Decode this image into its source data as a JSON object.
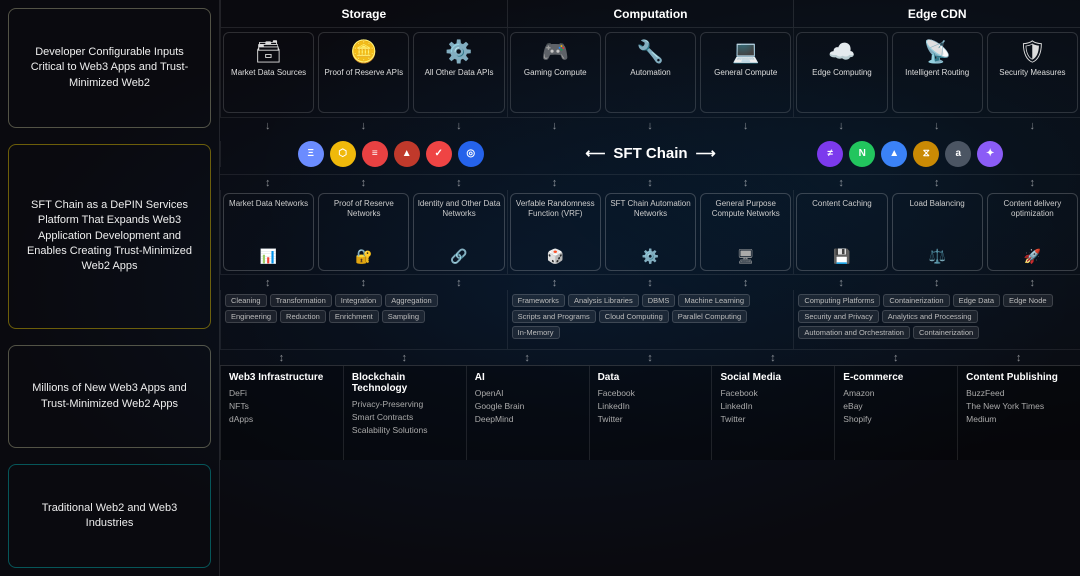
{
  "left": {
    "card1": {
      "text": "Developer Configurable Inputs Critical to Web3 Apps and Trust-Minimized Web2"
    },
    "card2": {
      "text": "SFT Chain as a DePIN Services Platform That Expands Web3 Application Development and Enables Creating Trust-Minimized Web2 Apps"
    },
    "card3": {
      "text": "Millions of New Web3 Apps and Trust-Minimized Web2 Apps"
    },
    "card4": {
      "text": "Traditional Web2 and Web3 Industries"
    }
  },
  "columns": {
    "storage": {
      "header": "Storage",
      "subcols": [
        {
          "label": "Market Data Sources",
          "icon": "🗃"
        },
        {
          "label": "Proof of Reserve APIs",
          "icon": "🪙"
        },
        {
          "label": "All Other Data APIs",
          "icon": "⚙️"
        }
      ],
      "networks": [
        {
          "label": "Market Data Networks",
          "icon": "📊"
        },
        {
          "label": "Proof of Reserve Networks",
          "icon": "🔐"
        },
        {
          "label": "Identity and Other Data Networks",
          "icon": "🔗"
        }
      ],
      "tags_row1": [
        "Cleaning",
        "Transformation",
        "Integration",
        "Aggregation"
      ],
      "tags_row2": [
        "Engineering",
        "Reduction",
        "Enrichment",
        "Sampling"
      ],
      "logos": [
        {
          "color": "#6b8cff",
          "text": "Ξ"
        },
        {
          "color": "#f0b90b",
          "text": "⬡"
        },
        {
          "color": "#e84142",
          "text": "≡"
        },
        {
          "color": "#e84142",
          "text": "▲"
        },
        {
          "color": "#ef4444",
          "text": "✓"
        },
        {
          "color": "#2563eb",
          "text": "◎"
        }
      ]
    },
    "computation": {
      "header": "Computation",
      "subcols": [
        {
          "label": "Gaming Compute",
          "icon": "🎮"
        },
        {
          "label": "Automation",
          "icon": "🔧"
        },
        {
          "label": "General Compute",
          "icon": "💻"
        }
      ],
      "networks": [
        {
          "label": "Verfable Randomness Function (VRF)",
          "icon": "🎲"
        },
        {
          "label": "SFT Chain Automation Networks",
          "icon": "⚙️"
        },
        {
          "label": "General Purpose Compute Networks",
          "icon": "🖥"
        }
      ],
      "tags_row1": [
        "Frameworks",
        "Analysis Libraries",
        "DBMS",
        "Machine Learning"
      ],
      "tags_row2": [
        "Scripts and Programs",
        "Cloud Computing",
        "Parallel Computing",
        "In-Memory"
      ],
      "sft_chain_label": "SFT Chain"
    },
    "edge_cdn": {
      "header": "Edge CDN",
      "subcols": [
        {
          "label": "Edge Computing",
          "icon": "☁️"
        },
        {
          "label": "Intelligent Routing",
          "icon": "📡"
        },
        {
          "label": "Security Measures",
          "icon": "🛡"
        }
      ],
      "networks": [
        {
          "label": "Content Caching",
          "icon": "💾"
        },
        {
          "label": "Load Balancing",
          "icon": "⚖️"
        },
        {
          "label": "Content delivery optimization",
          "icon": "🚀"
        }
      ],
      "tags_row1": [
        "Computing Platforms",
        "Containerization",
        "Edge Data",
        "Edge Node"
      ],
      "tags_row2": [
        "Security and Privacy",
        "Analytics and Processing",
        "Automation and Orchestration",
        "Containerization"
      ],
      "logos": [
        {
          "color": "#7c3aed",
          "text": "≠"
        },
        {
          "color": "#22c55e",
          "text": "N"
        },
        {
          "color": "#3b82f6",
          "text": "▲"
        },
        {
          "color": "#eab308",
          "text": "⧖"
        },
        {
          "color": "#6b7280",
          "text": "a"
        },
        {
          "color": "#8b5cf6",
          "text": "✦"
        }
      ]
    }
  },
  "industries": [
    {
      "title": "Web3 Infrastructure",
      "items": [
        "DeFi",
        "NFTs",
        "dApps"
      ]
    },
    {
      "title": "Blockchain Technology",
      "items": [
        "Privacy-Preserving",
        "Smart Contracts",
        "Scalability Solutions"
      ]
    },
    {
      "title": "AI",
      "items": [
        "OpenAI",
        "Google Brain",
        "DeepMind"
      ]
    },
    {
      "title": "Data",
      "items": [
        "Facebook",
        "LinkedIn",
        "Twitter"
      ]
    },
    {
      "title": "Social Media",
      "items": [
        "Facebook",
        "LinkedIn",
        "Twitter"
      ]
    },
    {
      "title": "E-commerce",
      "items": [
        "Amazon",
        "eBay",
        "Shopify"
      ]
    },
    {
      "title": "Content Publishing",
      "items": [
        "BuzzFeed",
        "The New York Times",
        "Medium"
      ]
    }
  ],
  "arrows": {
    "down": "↓",
    "updown": "↕",
    "left": "←",
    "right": "→"
  }
}
